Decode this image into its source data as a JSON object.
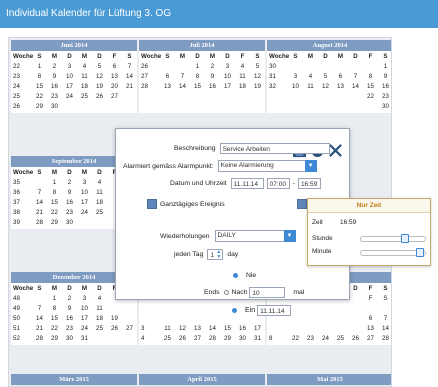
{
  "window": {
    "title": "Individual Kalender für Lüftung 3. OG"
  },
  "weekday_headers": [
    "Woche",
    "S",
    "M",
    "D",
    "M",
    "D",
    "F",
    "S"
  ],
  "months": [
    {
      "name": "Juni 2014",
      "rows": [
        [
          "22",
          "1",
          "2",
          "3",
          "4",
          "5",
          "6",
          "7"
        ],
        [
          "23",
          "8",
          "9",
          "10",
          "11",
          "12",
          "13",
          "14"
        ],
        [
          "24",
          "15",
          "16",
          "17",
          "18",
          "19",
          "20",
          "21"
        ],
        [
          "25",
          "22",
          "23",
          "24",
          "25",
          "26",
          "27",
          ""
        ],
        [
          "26",
          "29",
          "30",
          "",
          "",
          "",
          "",
          ""
        ]
      ]
    },
    {
      "name": "Juli 2014",
      "rows": [
        [
          "26",
          "",
          "",
          "1",
          "2",
          "3",
          "4",
          "5"
        ],
        [
          "27",
          "6",
          "7",
          "8",
          "9",
          "10",
          "11",
          "12"
        ],
        [
          "28",
          "13",
          "14",
          "15",
          "16",
          "17",
          "18",
          "19"
        ],
        [
          "",
          "",
          "",
          "",
          "",
          "",
          "",
          ""
        ],
        [
          "",
          "",
          "",
          "",
          "",
          "",
          "",
          ""
        ]
      ]
    },
    {
      "name": "August 2014",
      "rows": [
        [
          "30",
          "",
          "",
          "",
          "",
          "",
          "",
          "1",
          "2"
        ],
        [
          "31",
          "3",
          "4",
          "5",
          "6",
          "7",
          "8",
          "9"
        ],
        [
          "32",
          "10",
          "11",
          "12",
          "13",
          "14",
          "15",
          "16"
        ],
        [
          "",
          "",
          "",
          "",
          "",
          "",
          "22",
          "23"
        ],
        [
          "",
          "",
          "",
          "",
          "",
          "",
          "",
          "30"
        ]
      ]
    },
    {
      "name": "September 2014",
      "rows": [
        [
          "35",
          "",
          "1",
          "2",
          "3",
          "4",
          "",
          ""
        ],
        [
          "36",
          "7",
          "8",
          "9",
          "10",
          "11",
          "",
          ""
        ],
        [
          "37",
          "14",
          "15",
          "16",
          "17",
          "18",
          "",
          ""
        ],
        [
          "38",
          "21",
          "22",
          "23",
          "24",
          "25",
          "",
          ""
        ],
        [
          "39",
          "28",
          "29",
          "30",
          "",
          "",
          "",
          ""
        ]
      ]
    },
    {
      "name": "Dezember 2014",
      "rows": [
        [
          "48",
          "",
          "1",
          "2",
          "3",
          "4",
          "",
          ""
        ],
        [
          "49",
          "7",
          "8",
          "9",
          "10",
          "11",
          "",
          ""
        ],
        [
          "50",
          "14",
          "15",
          "16",
          "17",
          "18",
          "19",
          ""
        ],
        [
          "51",
          "21",
          "22",
          "23",
          "24",
          "25",
          "26",
          "27"
        ],
        [
          "52",
          "28",
          "29",
          "30",
          "31",
          "",
          "",
          ""
        ]
      ]
    },
    {
      "name": "Januar 2015",
      "rows": [
        [
          "",
          "",
          "",
          "",
          "",
          "",
          "",
          ""
        ],
        [
          "",
          "",
          "",
          "",
          "",
          "",
          "",
          ""
        ],
        [
          "",
          "",
          "",
          "",
          "",
          "",
          "",
          ""
        ],
        [
          "3",
          "11",
          "12",
          "13",
          "14",
          "15",
          "16",
          "17"
        ],
        [
          "4",
          "25",
          "26",
          "27",
          "28",
          "29",
          "30",
          "31"
        ]
      ]
    },
    {
      "name": "Februar 2015",
      "rows": [
        [
          "",
          "",
          "",
          "",
          "",
          "",
          "F",
          "S"
        ],
        [
          "",
          "",
          "",
          "",
          "",
          "",
          "",
          ""
        ],
        [
          "",
          "",
          "",
          "",
          "",
          "",
          "6",
          "7"
        ],
        [
          "",
          "",
          "",
          "",
          "",
          "",
          "13",
          "14"
        ],
        [
          "8",
          "22",
          "23",
          "24",
          "25",
          "26",
          "27",
          "28"
        ]
      ]
    }
  ],
  "month_labels_bottom": [
    "März 2015",
    "April 2015",
    "Mai 2015"
  ],
  "dialog": {
    "beschreibung_label": "Beschreibung",
    "beschreibung_value": "Service Arbeiten",
    "alarm_label": "Alarmiert gemäss Alarmpunkt:",
    "alarm_value": "Keine Alarmierung",
    "datetime_label": "Datum und Uhrzeit",
    "date_value": "11.11.14",
    "time_start": "07:00",
    "time_dash": "-",
    "time_end": "16:59",
    "allday_label": "Ganztägiges Ereignis",
    "repeat_label": "Wiederholungen",
    "repeat_value": "DAILY",
    "every_label": "jeden Tag",
    "every_value": "1",
    "every_unit": "day",
    "ends_label": "Ends",
    "never_label": "Nie",
    "after_label": "Nach",
    "after_value": "10",
    "after_unit": "mal",
    "on_label": "Ein",
    "on_value": "11.11.14"
  },
  "time_popup": {
    "title": "Nur Zeit",
    "zeit_label": "Zeit",
    "zeit_value": "16:59",
    "stunde_label": "Stunde",
    "stunde_fraction": 0.71,
    "minute_label": "Minute",
    "minute_fraction": 0.98
  },
  "colors": {
    "titlebar": "#4a9ad6",
    "month_header": "#7e9bc1",
    "accent": "#3d89d6",
    "popup_title": "#c07c10"
  }
}
